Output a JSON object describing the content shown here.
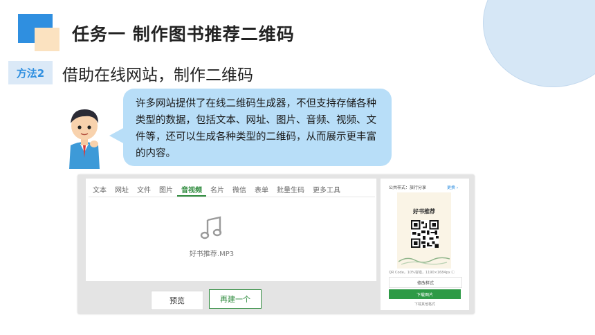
{
  "header": {
    "task_title": "任务一   制作图书推荐二维码",
    "method_badge": "方法2",
    "subtitle": "借助在线网站，制作二维码"
  },
  "bubble": {
    "text": "许多网站提供了在线二维码生成器，不但支持存储各种类型的数据，包括文本、网址、图片、音频、视频、文件等，还可以生成各种类型的二维码，从而展示更丰富的内容。"
  },
  "screenshot": {
    "tabs": [
      {
        "label": "文本",
        "active": false
      },
      {
        "label": "网址",
        "active": false
      },
      {
        "label": "文件",
        "active": false
      },
      {
        "label": "图片",
        "active": false
      },
      {
        "label": "音视频",
        "active": true
      },
      {
        "label": "名片",
        "active": false
      },
      {
        "label": "微信",
        "active": false
      },
      {
        "label": "表单",
        "active": false
      },
      {
        "label": "批量生码",
        "active": false
      },
      {
        "label": "更多工具",
        "active": false
      }
    ],
    "file_name": "好书推荐.MP3",
    "preview_button": "预览",
    "new_button": "再建一个",
    "side": {
      "style_label": "公共样式：旅行分享",
      "more_link": "更换 ›",
      "card_title": "好书推荐",
      "qr_caption": "QR Code，10%容错，1190×1684px ⓘ",
      "edit_style_button": "修改样式",
      "download_button": "下载图片",
      "other_formats_link": "下载其他格式"
    }
  },
  "colors": {
    "accent_blue": "#2f8fe0",
    "accent_green": "#2e8b3d",
    "bubble_blue": "#b8def8"
  }
}
